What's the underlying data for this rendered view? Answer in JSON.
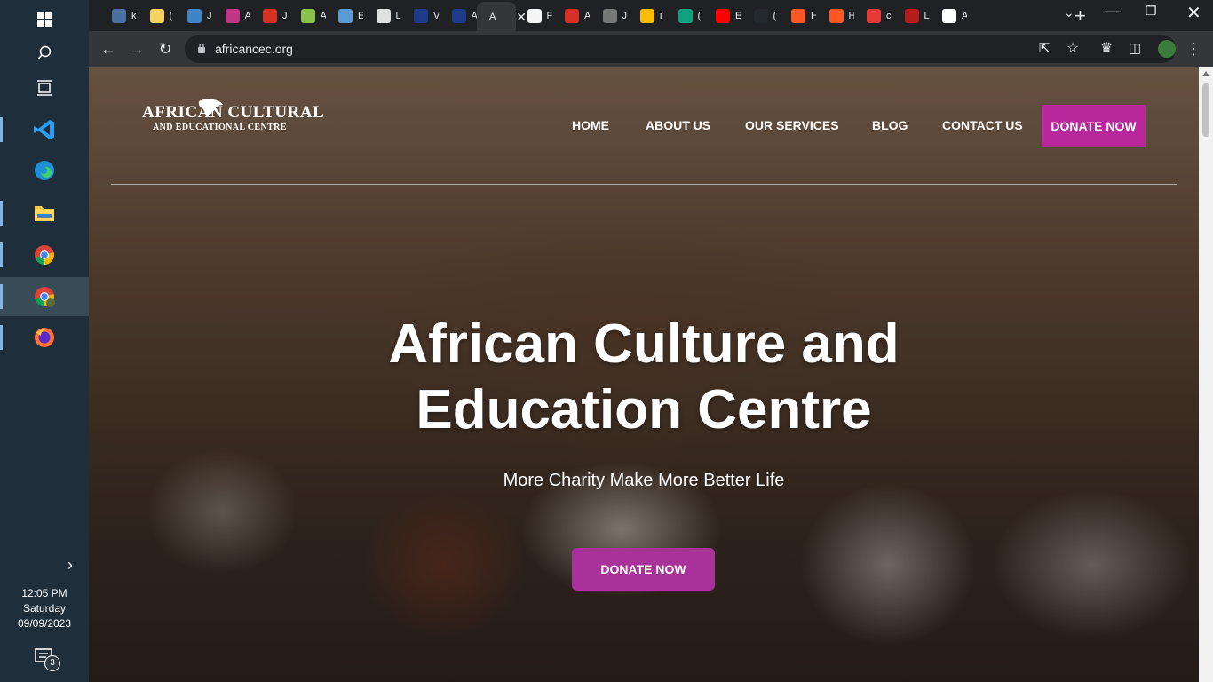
{
  "taskbar": {
    "time": "12:05 PM",
    "day": "Saturday",
    "date": "09/09/2023",
    "notification_count": "3",
    "apps": [
      "windows-start",
      "search",
      "task-view",
      "vscode",
      "edge",
      "file-explorer",
      "chrome",
      "chrome-profile",
      "firefox"
    ]
  },
  "browser": {
    "url": "africancec.org",
    "active_tab_letter": "A",
    "tabs": [
      {
        "letter": "k",
        "color": "#4a6fa5"
      },
      {
        "letter": "(",
        "color": "#f4d35e"
      },
      {
        "letter": "J",
        "color": "#3d85c6"
      },
      {
        "letter": "A",
        "color": "#c13584"
      },
      {
        "letter": "J",
        "color": "#d93025"
      },
      {
        "letter": "A",
        "color": "#8bc34a"
      },
      {
        "letter": "E",
        "color": "#5b9bd5"
      },
      {
        "letter": "L",
        "color": "#e0e0e0"
      },
      {
        "letter": "V",
        "color": "#1e3a8a"
      },
      {
        "letter": "A",
        "color": "#1e3a8a"
      },
      {
        "letter": "A",
        "color": "#35363a"
      },
      {
        "letter": "F",
        "color": "#f5f5f5"
      },
      {
        "letter": "A",
        "color": "#d93025"
      },
      {
        "letter": "J",
        "color": "#777777"
      },
      {
        "letter": "i",
        "color": "#fbbc04"
      },
      {
        "letter": "(",
        "color": "#10a37f"
      },
      {
        "letter": "E",
        "color": "#ff0000"
      },
      {
        "letter": "(",
        "color": "#24292e"
      },
      {
        "letter": "H",
        "color": "#ff5722"
      },
      {
        "letter": "H",
        "color": "#ff5722"
      },
      {
        "letter": "c",
        "color": "#e53935"
      },
      {
        "letter": "L",
        "color": "#b71c1c"
      },
      {
        "letter": "A",
        "color": "#ffffff"
      }
    ]
  },
  "site": {
    "logo_main": "AFRICAN CULTURAL",
    "logo_sub": "AND EDUCATIONAL CENTRE",
    "nav": {
      "home": "HOME",
      "about": "ABOUT US",
      "services": "OUR SERVICES",
      "blog": "BLOG",
      "contact": "CONTACT US",
      "donate": "DONATE NOW"
    },
    "hero": {
      "title_line1": "African Culture and",
      "title_line2": "Education Centre",
      "subtitle": "More Charity Make More Better Life",
      "cta": "DONATE NOW"
    },
    "colors": {
      "donate_nav_bg": "#b8279b",
      "donate_cta_bg": "#a8329a"
    }
  }
}
